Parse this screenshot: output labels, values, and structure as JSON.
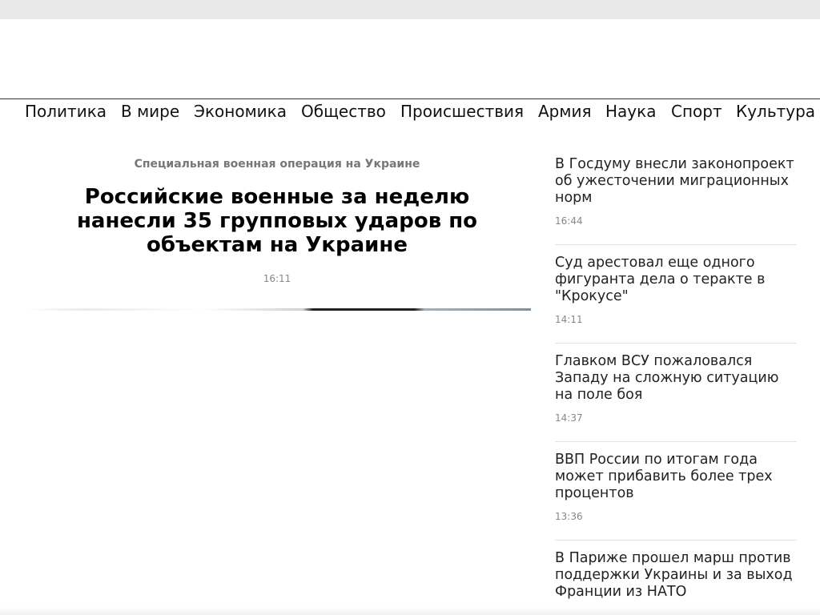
{
  "nav": {
    "items": [
      "Политика",
      "В мире",
      "Экономика",
      "Общество",
      "Происшествия",
      "Армия",
      "Наука",
      "Спорт",
      "Культура"
    ]
  },
  "article": {
    "rubric": "Специальная военная операция на Украине",
    "headline": "Российские военные за неделю нанесли 35 групповых ударов по объектам на Украине",
    "time": "16:11"
  },
  "sidebar": {
    "news": [
      {
        "title": "В Госдуму внесли законопроект об ужесточении миграционных норм",
        "time": "16:44"
      },
      {
        "title": "Суд арестовал еще одного фигуранта дела о теракте в \"Крокусе\"",
        "time": "14:11"
      },
      {
        "title": "Главком ВСУ пожаловался Западу на сложную ситуацию на поле боя",
        "time": "14:37"
      },
      {
        "title": "ВВП России по итогам года может прибавить более трех процентов",
        "time": "13:36"
      },
      {
        "title": "В Париже прошел марш против поддержки Украины и за выход Франции из НАТО",
        "time": ""
      }
    ]
  }
}
